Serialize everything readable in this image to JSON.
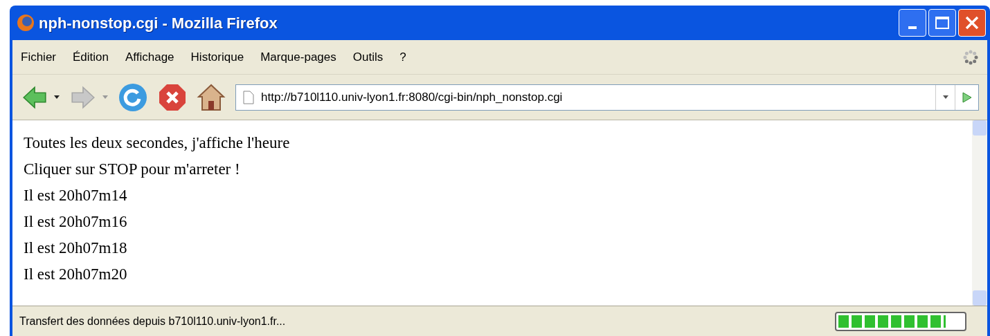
{
  "window": {
    "title": "nph-nonstop.cgi - Mozilla Firefox"
  },
  "menu": [
    "Fichier",
    "Édition",
    "Affichage",
    "Historique",
    "Marque-pages",
    "Outils",
    "?"
  ],
  "toolbar": {
    "back": {
      "disabled": false
    },
    "forward": {
      "disabled": true
    },
    "address": "http://b710l110.univ-lyon1.fr:8080/cgi-bin/nph_nonstop.cgi"
  },
  "content": {
    "lines": [
      "Toutes les deux secondes, j'affiche l'heure",
      "Cliquer sur STOP pour m'arreter !",
      "Il est 20h07m14",
      "Il est 20h07m16",
      "Il est 20h07m18",
      "Il est 20h07m20"
    ]
  },
  "status_bar": {
    "text": "Transfert des données depuis b710l110.univ-lyon1.fr...",
    "progress": {
      "level": 0.86
    }
  }
}
